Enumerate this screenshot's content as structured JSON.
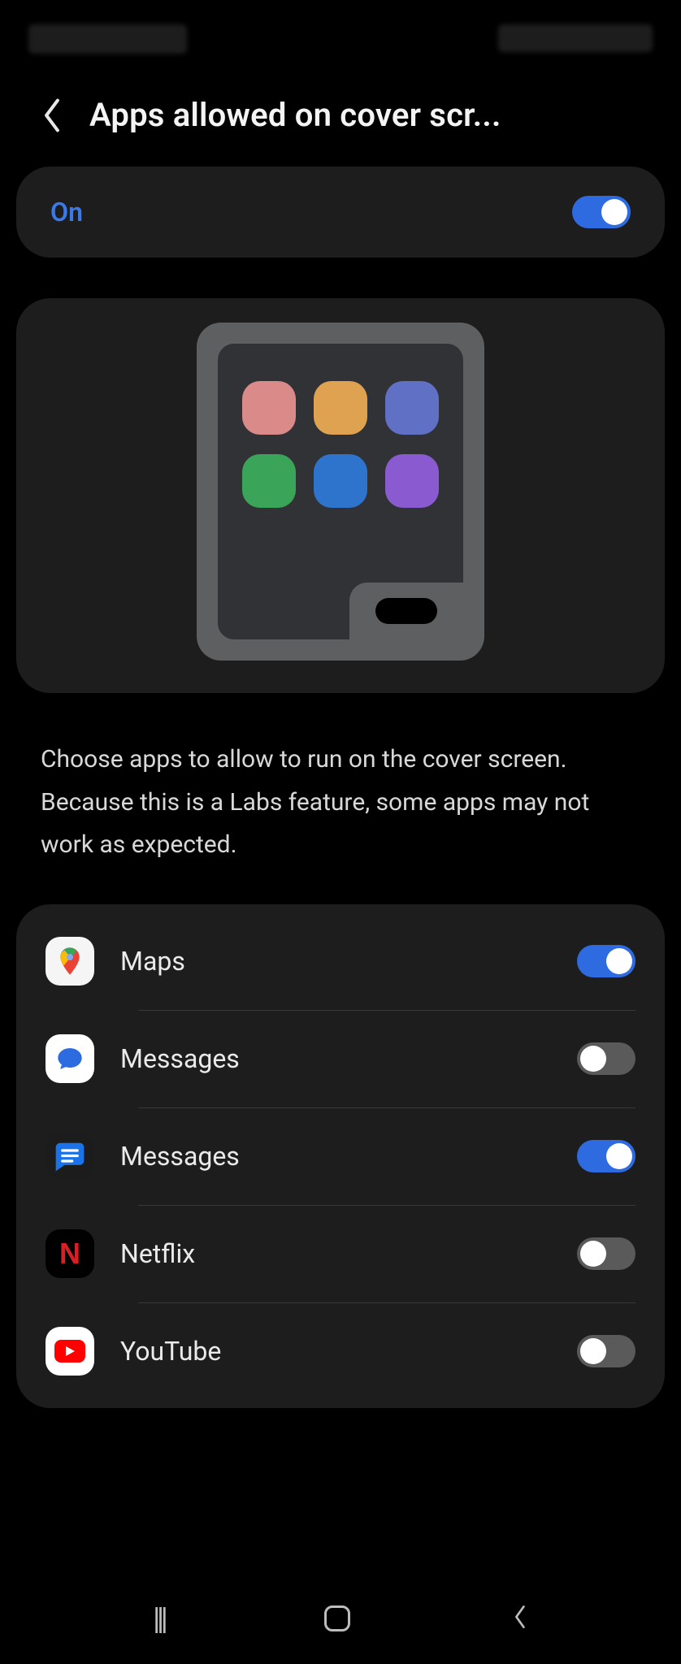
{
  "header": {
    "title": "Apps allowed on cover scr..."
  },
  "master": {
    "label": "On",
    "enabled": true
  },
  "description": "Choose apps to allow to run on the cover screen. Because this is a Labs feature, some apps may not work as expected.",
  "apps": [
    {
      "name": "Maps",
      "icon": "maps-icon",
      "enabled": true
    },
    {
      "name": "Messages",
      "icon": "samsung-messages-icon",
      "enabled": false
    },
    {
      "name": "Messages",
      "icon": "google-messages-icon",
      "enabled": true
    },
    {
      "name": "Netflix",
      "icon": "netflix-icon",
      "enabled": false
    },
    {
      "name": "YouTube",
      "icon": "youtube-icon",
      "enabled": false
    }
  ],
  "illustration": {
    "grid_colors": [
      "pink",
      "orange",
      "blue",
      "green",
      "blue",
      "purple"
    ]
  }
}
